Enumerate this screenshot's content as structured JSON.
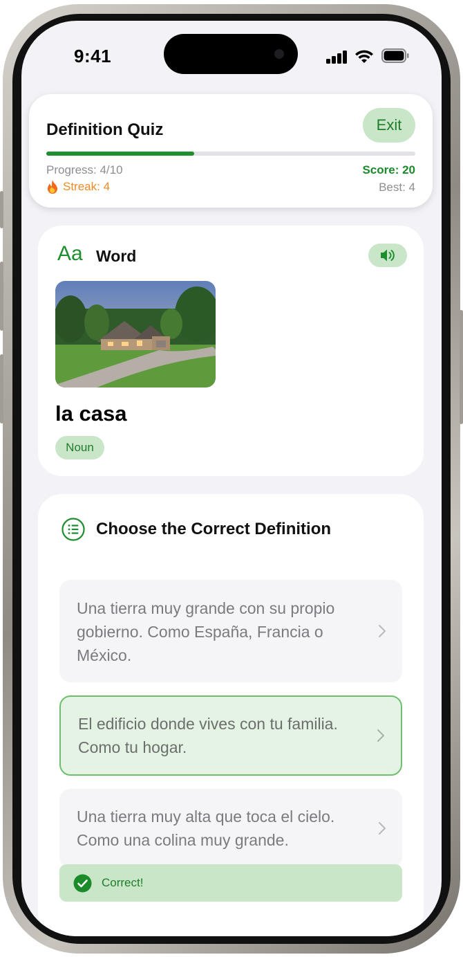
{
  "status_bar": {
    "time": "9:41"
  },
  "header": {
    "title": "Definition Quiz",
    "exit_label": "Exit",
    "progress_text": "Progress: 4/10",
    "progress_fraction": 0.4,
    "score_text": "Score: 20",
    "streak_text": "Streak: 4",
    "best_text": "Best: 4"
  },
  "word_card": {
    "icon_glyph": "Aa",
    "label": "Word",
    "word": "la casa",
    "part_of_speech": "Noun",
    "image_icon": "house-photo",
    "speaker_icon": "speaker-icon"
  },
  "quiz": {
    "heading": "Choose the Correct Definition",
    "options": [
      {
        "line1": "Una tierra muy grande con su propio",
        "line2": "gobierno. Como España, Francia o",
        "line3": "México."
      },
      {
        "line1": "El edificio donde vives con tu familia.",
        "line2": "Como tu hogar."
      },
      {
        "line1": "Una tierra muy alta que toca el cielo.",
        "line2": "Como una colina muy grande."
      }
    ],
    "feedback": "Correct!"
  },
  "colors": {
    "accent_green": "#1e8e2e",
    "light_green": "#c9e6c9",
    "streak_orange": "#f08a24",
    "background": "#f2f2f7"
  }
}
